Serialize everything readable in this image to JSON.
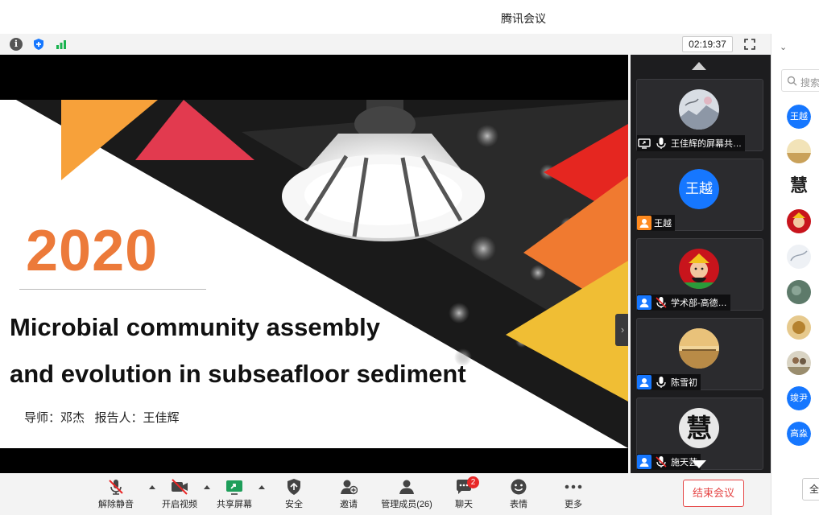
{
  "window": {
    "title": "腾讯会议"
  },
  "infobar": {
    "timer": "02:19:37"
  },
  "slide": {
    "year": "2020",
    "title_line1": "Microbial community assembly",
    "title_line2": "and evolution in subseafloor sediment",
    "authors": "导师：邓杰   报告人：王佳辉"
  },
  "participants": [
    {
      "name": "王佳辉的屏幕共…",
      "avatar": "landscape-photo",
      "mic": "on",
      "screen_share": true
    },
    {
      "name": "王越",
      "avatar_text": "王越",
      "avatar_color": "#1677ff",
      "mic": "none",
      "role_color": "#ff8a1f"
    },
    {
      "name": "学术部-高德…",
      "avatar": "deity-portrait",
      "mic": "muted"
    },
    {
      "name": "陈雪初",
      "avatar": "sunset-photo",
      "mic": "on"
    },
    {
      "name": "施天芸",
      "avatar_text": "慧",
      "mic": "muted"
    }
  ],
  "toolbar": {
    "unmute": "解除静音",
    "video": "开启视频",
    "share": "共享屏幕",
    "security": "安全",
    "invite": "邀请",
    "manage_members": "管理成员(26)",
    "chat": "聊天",
    "chat_badge": "2",
    "reactions": "表情",
    "more": "更多",
    "end_meeting": "结束会议"
  },
  "member_panel": {
    "search_placeholder": "搜索",
    "members": [
      {
        "avatar_text": "王越"
      },
      {
        "avatar": "field-photo"
      },
      {
        "avatar_text": "慧"
      },
      {
        "avatar": "deity-portrait"
      },
      {
        "avatar": "sketch-photo"
      },
      {
        "avatar": "nature-photo"
      },
      {
        "avatar": "food-photo"
      },
      {
        "avatar": "people-photo"
      },
      {
        "avatar_text": "竣尹"
      },
      {
        "avatar_text": "高淼"
      }
    ],
    "bottom_button": "全"
  },
  "colors": {
    "accent": "#1677ff",
    "danger": "#e54545",
    "slide_year": "#ec7a3a"
  }
}
